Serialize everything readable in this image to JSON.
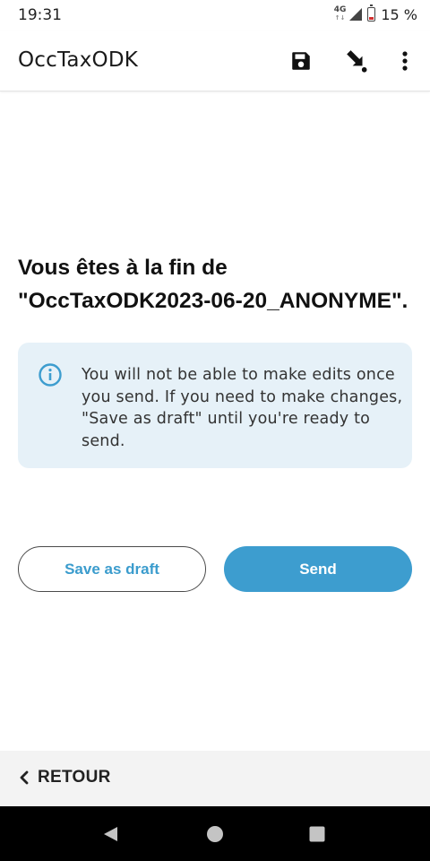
{
  "status_bar": {
    "time": "19:31",
    "network": "4G",
    "network_arrows": "↑↓",
    "battery_percent": "15 %"
  },
  "app_bar": {
    "title": "OccTaxODK",
    "icons": [
      "save-icon",
      "jump-icon",
      "more-vert-icon"
    ]
  },
  "content": {
    "end_title": "Vous êtes à la fin de \"OccTaxODK2023-06-20_ANONYME\".",
    "info_text": "You will not be able to make edits once you send. If you need to make changes, \"Save as draft\" until you're ready to send.",
    "save_draft_label": "Save as draft",
    "send_label": "Send"
  },
  "footer": {
    "retour_label": "RETOUR"
  },
  "colors": {
    "accent": "#3d9dcf",
    "info_bg": "#e6f1f8",
    "battery_low": "#d32f2f"
  }
}
